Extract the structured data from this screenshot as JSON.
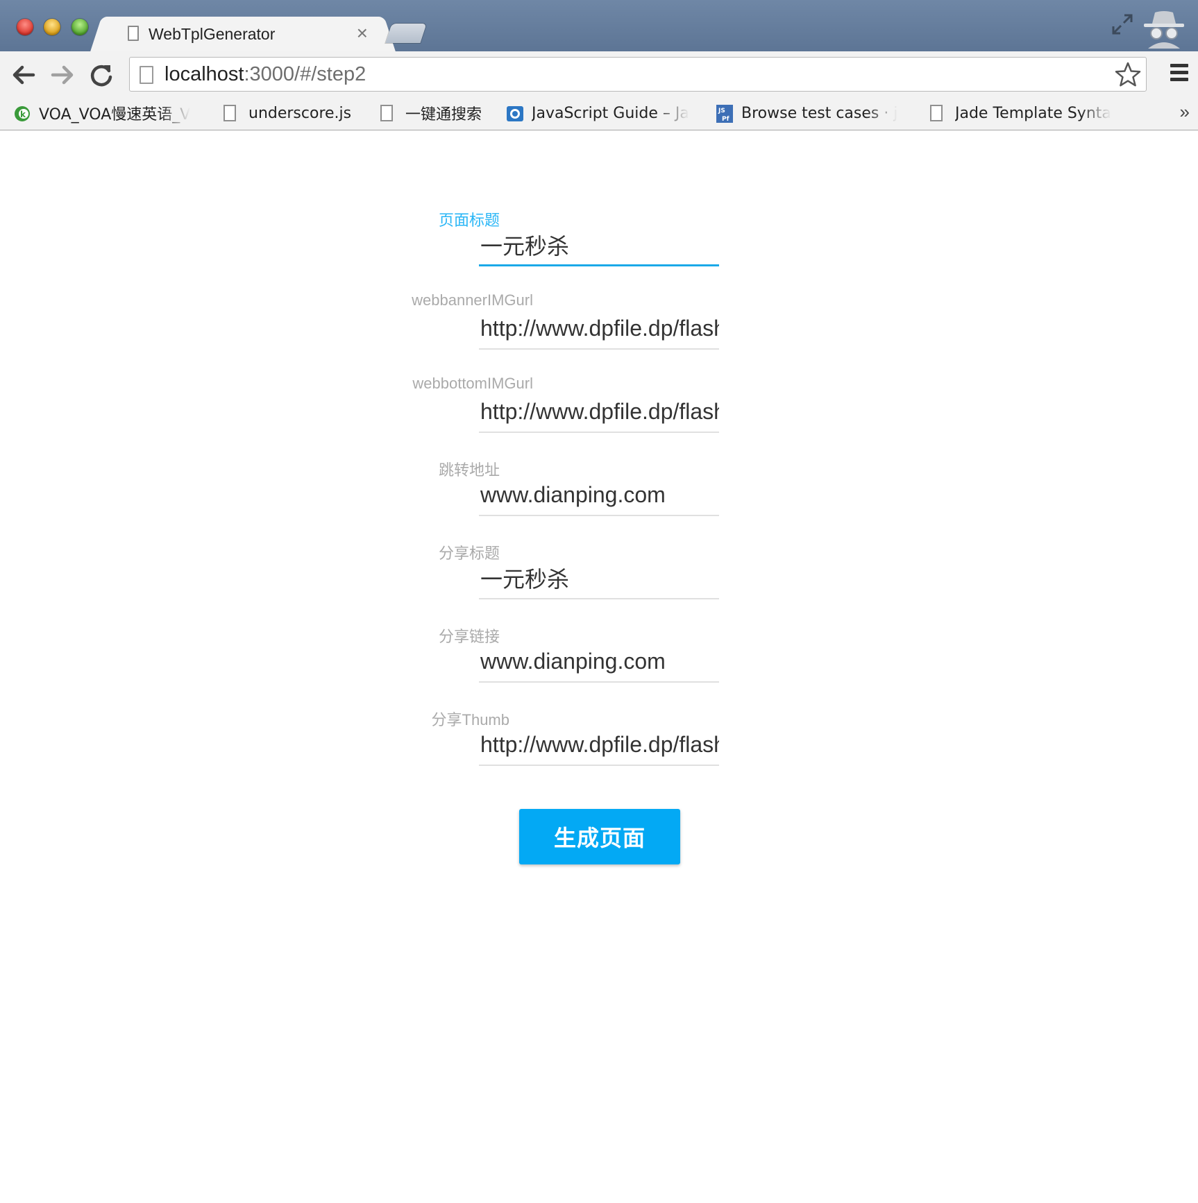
{
  "browser": {
    "tab_title": "WebTplGenerator",
    "tab_close": "×",
    "url_host": "localhost",
    "url_rest": ":3000/#/step2"
  },
  "bookmarks": {
    "items": [
      {
        "label": "VOA_VOA慢速英语_V",
        "icon": "voa-favicon"
      },
      {
        "label": "underscore.js",
        "icon": "page-icon"
      },
      {
        "label": "一键通搜索",
        "icon": "page-icon"
      },
      {
        "label": "JavaScript Guide – Ja",
        "icon": "mdn-favicon"
      },
      {
        "label": "Browse test cases · j",
        "icon": "jsperf-favicon"
      },
      {
        "label": "Jade Template Synta",
        "icon": "page-icon"
      }
    ],
    "overflow": "»"
  },
  "form": {
    "fields": [
      {
        "label": "页面标题",
        "value": "一元秒杀"
      },
      {
        "label": "webbannerIMGurl",
        "value": "http://www.dpfile.dp/flash"
      },
      {
        "label": "webbottomIMGurl",
        "value": "http://www.dpfile.dp/flash"
      },
      {
        "label": "跳转地址",
        "value": "www.dianping.com"
      },
      {
        "label": "分享标题",
        "value": "一元秒杀"
      },
      {
        "label": "分享链接",
        "value": "www.dianping.com"
      },
      {
        "label": "分享Thumb",
        "value": "http://www.dpfile.dp/flash"
      }
    ],
    "submit_label": "生成页面"
  },
  "colors": {
    "accent": "#03a9f4",
    "focused_label": "#29b6f6",
    "label": "#aaaaaa"
  }
}
